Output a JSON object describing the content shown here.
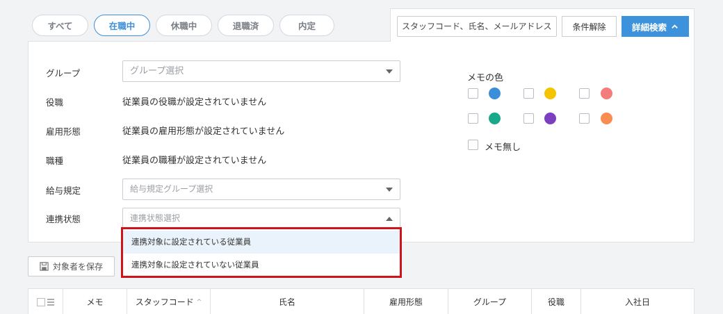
{
  "tabs": [
    {
      "label": "すべて",
      "active": false
    },
    {
      "label": "在職中",
      "active": true
    },
    {
      "label": "休職中",
      "active": false
    },
    {
      "label": "退職済",
      "active": false
    },
    {
      "label": "内定",
      "active": false
    }
  ],
  "search": {
    "placeholder": "スタッフコード、氏名、メールアドレス",
    "clear_label": "条件解除",
    "detail_label": "詳細検索"
  },
  "filters": {
    "group": {
      "label": "グループ",
      "placeholder": "グループ選択"
    },
    "position": {
      "label": "役職",
      "text": "従業員の役職が設定されていません"
    },
    "employment_type": {
      "label": "雇用形態",
      "text": "従業員の雇用形態が設定されていません"
    },
    "job_type": {
      "label": "職種",
      "text": "従業員の職種が設定されていません"
    },
    "salary_rule": {
      "label": "給与規定",
      "placeholder": "給与規定グループ選択"
    },
    "link_status": {
      "label": "連携状態",
      "placeholder": "連携状態選択",
      "options": [
        "連携対象に設定されている従業員",
        "連携対象に設定されていない従業員"
      ]
    }
  },
  "memo": {
    "title": "メモの色",
    "colors": [
      "#3b8fd9",
      "#f5c400",
      "#f27d7b",
      "#1aa88a",
      "#7b3fbf",
      "#f98c4f"
    ],
    "none_label": "メモ無し"
  },
  "save_label": "対象者を保存",
  "table": {
    "headers": [
      "メモ",
      "スタッフコード",
      "氏名",
      "雇用形態",
      "グループ",
      "役職",
      "入社日"
    ],
    "sort_glyph": "^"
  }
}
